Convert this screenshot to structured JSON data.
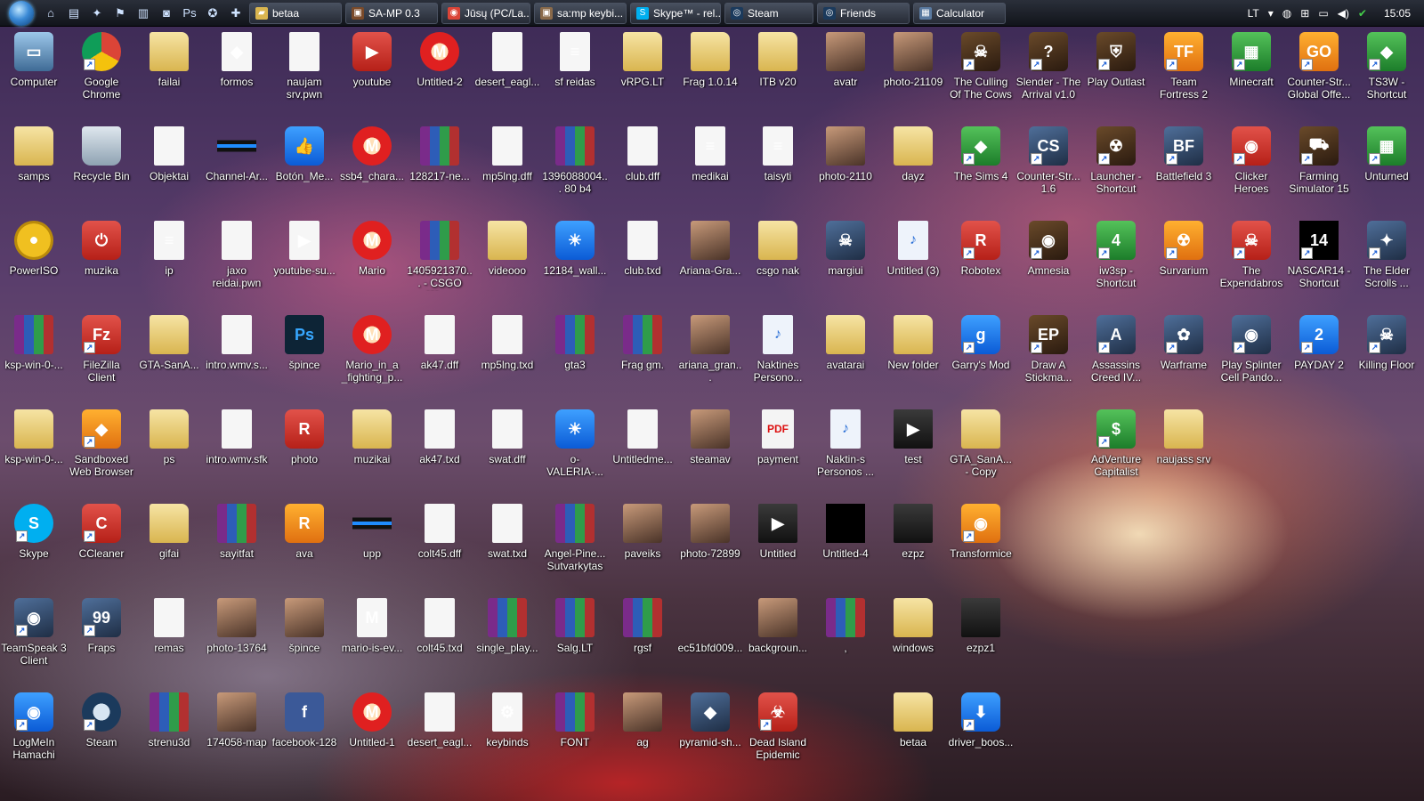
{
  "taskbar": {
    "buttons": [
      {
        "label": "betaa",
        "color": "#d9b54f",
        "glyph": "▰"
      },
      {
        "label": "SA-MP 0.3",
        "color": "#7a4a2a",
        "glyph": "▣"
      },
      {
        "label": "Jūsų (PC/La...",
        "color": "#db4437",
        "glyph": "◉"
      },
      {
        "label": "sa:mp keybi...",
        "color": "#8a6a4a",
        "glyph": "▣"
      },
      {
        "label": "Skype™ - rel...",
        "color": "#00aff0",
        "glyph": "S"
      },
      {
        "label": "Steam",
        "color": "#1b3a5c",
        "glyph": "◎"
      },
      {
        "label": "Friends",
        "color": "#1b3a5c",
        "glyph": "◎"
      },
      {
        "label": "Calculator",
        "color": "#5a7aa0",
        "glyph": "▦"
      }
    ],
    "quick": [
      "⌂",
      "▤",
      "✦",
      "⚑",
      "▥",
      "◙",
      "Ps",
      "✪",
      "✚"
    ],
    "tray": {
      "lang": "LT",
      "clock": "15:05"
    }
  },
  "desktop_icons": [
    [
      {
        "label": "Computer",
        "type": "pc",
        "glyph": "▭"
      },
      {
        "label": "Google Chrome",
        "type": "chrome",
        "glyph": "",
        "shortcut": true
      },
      {
        "label": "failai",
        "type": "folder",
        "glyph": ""
      },
      {
        "label": "formos",
        "type": "file",
        "glyph": "◆"
      },
      {
        "label": "naujam srv.pwn",
        "type": "file",
        "glyph": ""
      },
      {
        "label": "youtube",
        "type": "red",
        "glyph": "▶"
      },
      {
        "label": "Untitled-2",
        "type": "mario",
        "glyph": "M"
      },
      {
        "label": "desert_eagl...",
        "type": "file",
        "glyph": ""
      },
      {
        "label": "sf reidas",
        "type": "file",
        "glyph": "≡"
      },
      {
        "label": "vRPG.LT",
        "type": "folder",
        "glyph": ""
      },
      {
        "label": "Frag 1.0.14",
        "type": "folder",
        "glyph": ""
      },
      {
        "label": "ITB v20",
        "type": "folder",
        "glyph": ""
      },
      {
        "label": "avatr",
        "type": "image",
        "glyph": ""
      },
      {
        "label": "photo-21109",
        "type": "image",
        "glyph": ""
      },
      {
        "label": "The Culling Of The Cows",
        "type": "game",
        "glyph": "☠",
        "shortcut": true
      },
      {
        "label": "Slender - The Arrival v1.0",
        "type": "game",
        "glyph": "?",
        "shortcut": true
      },
      {
        "label": "Play Outlast",
        "type": "game",
        "glyph": "⛨",
        "shortcut": true
      },
      {
        "label": "Team Fortress 2",
        "type": "orange",
        "glyph": "TF",
        "shortcut": true
      },
      {
        "label": "Minecraft",
        "type": "green",
        "glyph": "▦",
        "shortcut": true
      },
      {
        "label": "Counter-Str... Global Offe...",
        "type": "orange",
        "glyph": "GO",
        "shortcut": true
      },
      {
        "label": "TS3W - Shortcut",
        "type": "green",
        "glyph": "◆",
        "shortcut": true
      }
    ],
    [
      {
        "label": "samps",
        "type": "folder",
        "glyph": ""
      },
      {
        "label": "Recycle Bin",
        "type": "bin",
        "glyph": ""
      },
      {
        "label": "Objektai",
        "type": "file",
        "glyph": ""
      },
      {
        "label": "Channel-Ar...",
        "type": "stripe",
        "glyph": ""
      },
      {
        "label": "Botón_Me...",
        "type": "blue",
        "glyph": "👍"
      },
      {
        "label": "ssb4_chara...",
        "type": "mario",
        "glyph": "M"
      },
      {
        "label": "128217-ne...",
        "type": "rar",
        "glyph": ""
      },
      {
        "label": "mp5lng.dff",
        "type": "file",
        "glyph": ""
      },
      {
        "label": "1396088004... 80 b4",
        "type": "rar",
        "glyph": ""
      },
      {
        "label": "club.dff",
        "type": "file",
        "glyph": ""
      },
      {
        "label": "medikai",
        "type": "file",
        "glyph": "≡"
      },
      {
        "label": "taisyti",
        "type": "file",
        "glyph": "≡"
      },
      {
        "label": "photo-2110",
        "type": "image",
        "glyph": ""
      },
      {
        "label": "dayz",
        "type": "folder",
        "glyph": ""
      },
      {
        "label": "The Sims 4",
        "type": "green",
        "glyph": "◆",
        "shortcut": true
      },
      {
        "label": "Counter-Str... 1.6",
        "type": "app",
        "glyph": "CS",
        "shortcut": true
      },
      {
        "label": "Launcher - Shortcut",
        "type": "game",
        "glyph": "☢",
        "shortcut": true
      },
      {
        "label": "Battlefield 3",
        "type": "app",
        "glyph": "BF",
        "shortcut": true
      },
      {
        "label": "Clicker Heroes",
        "type": "red",
        "glyph": "◉",
        "shortcut": true
      },
      {
        "label": "Farming Simulator 15",
        "type": "game",
        "glyph": "⛟",
        "shortcut": true
      },
      {
        "label": "Unturned",
        "type": "green",
        "glyph": "▦",
        "shortcut": true
      }
    ],
    [
      {
        "label": "PowerISO",
        "type": "disc",
        "glyph": ""
      },
      {
        "label": "muzika",
        "type": "red",
        "glyph": "⏻"
      },
      {
        "label": "ip",
        "type": "file",
        "glyph": "≡"
      },
      {
        "label": "jaxo reidai.pwn",
        "type": "file",
        "glyph": ""
      },
      {
        "label": "youtube-su...",
        "type": "file",
        "glyph": "▶"
      },
      {
        "label": "Mario",
        "type": "mario",
        "glyph": "M"
      },
      {
        "label": "1405921370... - CSGO We...",
        "type": "rar",
        "glyph": ""
      },
      {
        "label": "videooo",
        "type": "folder",
        "glyph": ""
      },
      {
        "label": "12184_wall...",
        "type": "blue",
        "glyph": "☀"
      },
      {
        "label": "club.txd",
        "type": "file",
        "glyph": ""
      },
      {
        "label": "Ariana-Gra...",
        "type": "image",
        "glyph": ""
      },
      {
        "label": "csgo nak",
        "type": "folder",
        "glyph": ""
      },
      {
        "label": "margiui",
        "type": "app",
        "glyph": "☠"
      },
      {
        "label": "Untitled (3)",
        "type": "audio",
        "glyph": "♪"
      },
      {
        "label": "Robotex",
        "type": "red",
        "glyph": "R",
        "shortcut": true
      },
      {
        "label": "Amnesia",
        "type": "game",
        "glyph": "◉",
        "shortcut": true
      },
      {
        "label": "iw3sp - Shortcut",
        "type": "green",
        "glyph": "4",
        "shortcut": true
      },
      {
        "label": "Survarium",
        "type": "orange",
        "glyph": "☢",
        "shortcut": true
      },
      {
        "label": "The Expendabros",
        "type": "red",
        "glyph": "☠",
        "shortcut": true
      },
      {
        "label": "NASCAR14 - Shortcut",
        "type": "black",
        "glyph": "14",
        "shortcut": true
      },
      {
        "label": "The Elder Scrolls ...",
        "type": "app",
        "glyph": "✦",
        "shortcut": true
      }
    ],
    [
      {
        "label": "ksp-win-0-...",
        "type": "rar",
        "glyph": ""
      },
      {
        "label": "FileZilla Client",
        "type": "red",
        "glyph": "Fz",
        "shortcut": true
      },
      {
        "label": "GTA-SanA...",
        "type": "folder",
        "glyph": ""
      },
      {
        "label": "intro.wmv.s...",
        "type": "file",
        "glyph": ""
      },
      {
        "label": "špince",
        "type": "ps",
        "glyph": "Ps"
      },
      {
        "label": "Mario_in_a _fighting_p...",
        "type": "mario",
        "glyph": "M"
      },
      {
        "label": "ak47.dff",
        "type": "file",
        "glyph": ""
      },
      {
        "label": "mp5lng.txd",
        "type": "file",
        "glyph": ""
      },
      {
        "label": "gta3",
        "type": "rar",
        "glyph": ""
      },
      {
        "label": "Frag gm.",
        "type": "rar",
        "glyph": ""
      },
      {
        "label": "ariana_gran...",
        "type": "image",
        "glyph": ""
      },
      {
        "label": "Naktinės Persono...",
        "type": "audio",
        "glyph": "♪"
      },
      {
        "label": "avatarai",
        "type": "folder",
        "glyph": ""
      },
      {
        "label": "New folder",
        "type": "folder",
        "glyph": ""
      },
      {
        "label": "Garry's Mod",
        "type": "blue",
        "glyph": "g",
        "shortcut": true
      },
      {
        "label": "Draw A Stickma...",
        "type": "game",
        "glyph": "EP",
        "shortcut": true
      },
      {
        "label": "Assassins Creed IV...",
        "type": "app",
        "glyph": "A",
        "shortcut": true
      },
      {
        "label": "Warframe",
        "type": "app",
        "glyph": "✿",
        "shortcut": true
      },
      {
        "label": "Play Splinter Cell Pando...",
        "type": "app",
        "glyph": "◉",
        "shortcut": true
      },
      {
        "label": "PAYDAY 2",
        "type": "blue",
        "glyph": "2",
        "shortcut": true
      },
      {
        "label": "Killing Floor",
        "type": "app",
        "glyph": "☠",
        "shortcut": true
      }
    ],
    [
      {
        "label": "ksp-win-0-...",
        "type": "folder",
        "glyph": ""
      },
      {
        "label": "Sandboxed Web Browser",
        "type": "orange",
        "glyph": "◆",
        "shortcut": true
      },
      {
        "label": "ps",
        "type": "folder",
        "glyph": ""
      },
      {
        "label": "intro.wmv.sfk",
        "type": "file",
        "glyph": ""
      },
      {
        "label": "photo",
        "type": "red",
        "glyph": "R"
      },
      {
        "label": "muzikai",
        "type": "folder",
        "glyph": ""
      },
      {
        "label": "ak47.txd",
        "type": "file",
        "glyph": ""
      },
      {
        "label": "swat.dff",
        "type": "file",
        "glyph": ""
      },
      {
        "label": "o-VALERIA-...",
        "type": "blue",
        "glyph": "☀"
      },
      {
        "label": "Untitledme...",
        "type": "file",
        "glyph": ""
      },
      {
        "label": "steamav",
        "type": "image",
        "glyph": ""
      },
      {
        "label": "payment",
        "type": "pdf",
        "glyph": "PDF"
      },
      {
        "label": "Naktin-s Personos ...",
        "type": "audio",
        "glyph": "♪"
      },
      {
        "label": "test",
        "type": "video",
        "glyph": "▶"
      },
      {
        "label": "GTA_SanA... - Copy",
        "type": "folder",
        "glyph": ""
      },
      {
        "label": "",
        "type": "",
        "glyph": ""
      },
      {
        "label": "AdVenture Capitalist",
        "type": "green",
        "glyph": "$",
        "shortcut": true
      },
      {
        "label": "naujass srv",
        "type": "folder",
        "glyph": ""
      }
    ],
    [
      {
        "label": "Skype",
        "type": "skype",
        "glyph": "S",
        "shortcut": true
      },
      {
        "label": "CCleaner",
        "type": "red",
        "glyph": "C",
        "shortcut": true
      },
      {
        "label": "gifai",
        "type": "folder",
        "glyph": ""
      },
      {
        "label": "sayitfat",
        "type": "rar",
        "glyph": ""
      },
      {
        "label": "ava",
        "type": "orange",
        "glyph": "R"
      },
      {
        "label": "upp",
        "type": "stripe",
        "glyph": ""
      },
      {
        "label": "colt45.dff",
        "type": "file",
        "glyph": ""
      },
      {
        "label": "swat.txd",
        "type": "file",
        "glyph": ""
      },
      {
        "label": "Angel-Pine... Sutvarkytas",
        "type": "rar",
        "glyph": ""
      },
      {
        "label": "paveiks",
        "type": "image",
        "glyph": ""
      },
      {
        "label": "photo-72899",
        "type": "image",
        "glyph": ""
      },
      {
        "label": "Untitled",
        "type": "video",
        "glyph": "▶"
      },
      {
        "label": "Untitled-4",
        "type": "black",
        "glyph": ""
      },
      {
        "label": "ezpz",
        "type": "video",
        "glyph": ""
      },
      {
        "label": "Transformice",
        "type": "orange",
        "glyph": "◉",
        "shortcut": true
      }
    ],
    [
      {
        "label": "TeamSpeak 3 Client",
        "type": "app",
        "glyph": "◉",
        "shortcut": true
      },
      {
        "label": "Fraps",
        "type": "app",
        "glyph": "99",
        "shortcut": true
      },
      {
        "label": "remas",
        "type": "file",
        "glyph": ""
      },
      {
        "label": "photo-13764",
        "type": "image",
        "glyph": ""
      },
      {
        "label": "špince",
        "type": "image",
        "glyph": ""
      },
      {
        "label": "mario-is-ev...",
        "type": "file",
        "glyph": "M"
      },
      {
        "label": "colt45.txd",
        "type": "file",
        "glyph": ""
      },
      {
        "label": "single_play...",
        "type": "rar",
        "glyph": ""
      },
      {
        "label": "Salg.LT",
        "type": "rar",
        "glyph": ""
      },
      {
        "label": "rgsf",
        "type": "rar",
        "glyph": ""
      },
      {
        "label": "ec51bfd009...",
        "type": "",
        "glyph": ""
      },
      {
        "label": "backgroun...",
        "type": "image",
        "glyph": ""
      },
      {
        "label": ",",
        "type": "rar",
        "glyph": ""
      },
      {
        "label": "windows",
        "type": "folder",
        "glyph": ""
      },
      {
        "label": "ezpz1",
        "type": "video",
        "glyph": ""
      }
    ],
    [
      {
        "label": "LogMeIn Hamachi",
        "type": "blue",
        "glyph": "◉",
        "shortcut": true
      },
      {
        "label": "Steam",
        "type": "steam",
        "glyph": "",
        "shortcut": true
      },
      {
        "label": "strenu3d",
        "type": "rar",
        "glyph": ""
      },
      {
        "label": "174058-map",
        "type": "image",
        "glyph": ""
      },
      {
        "label": "facebook-128",
        "type": "fb",
        "glyph": "f"
      },
      {
        "label": "Untitled-1",
        "type": "mario",
        "glyph": "M"
      },
      {
        "label": "desert_eagl...",
        "type": "file",
        "glyph": ""
      },
      {
        "label": "keybinds",
        "type": "file",
        "glyph": "⚙"
      },
      {
        "label": "FONT",
        "type": "rar",
        "glyph": ""
      },
      {
        "label": "ag",
        "type": "image",
        "glyph": ""
      },
      {
        "label": "pyramid-sh...",
        "type": "app",
        "glyph": "◆"
      },
      {
        "label": "Dead Island Epidemic",
        "type": "red",
        "glyph": "☣",
        "shortcut": true
      },
      {
        "label": "",
        "type": "",
        "glyph": ""
      },
      {
        "label": "betaa",
        "type": "folder",
        "glyph": ""
      },
      {
        "label": "driver_boos...",
        "type": "blue",
        "glyph": "⬇",
        "shortcut": true
      }
    ]
  ]
}
